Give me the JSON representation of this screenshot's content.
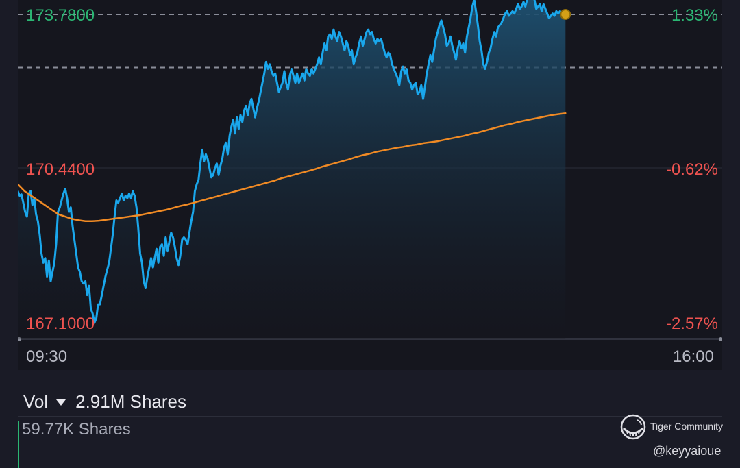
{
  "colors": {
    "price_line": "#1aa7ec",
    "avg_line": "#f08a24",
    "up_text": "#2bb673",
    "down_text": "#ef5350",
    "dashed_line": "#8a8d99",
    "time_text": "#b8bac4",
    "end_dot": "#d4a017"
  },
  "chart_data": {
    "type": "line",
    "x_labels": [
      "09:30",
      "16:00"
    ],
    "y_labels": {
      "left": [
        "173.7800",
        "170.4400",
        "167.1000"
      ],
      "right": [
        "1.33%",
        "-0.62%",
        "-2.57%"
      ]
    },
    "ylim": [
      167.1,
      173.78
    ],
    "reference_price": 171.5,
    "dashed_levels": [
      173.78,
      172.63
    ],
    "series": [
      {
        "key": "price",
        "values": [
          169.95,
          169.85,
          169.88,
          169.7,
          169.5,
          169.4,
          169.9,
          169.95,
          169.65,
          169.8,
          169.45,
          169.3,
          169.0,
          168.6,
          168.4,
          168.5,
          168.1,
          168.45,
          168.0,
          168.2,
          168.4,
          168.8,
          169.5,
          169.6,
          169.75,
          169.9,
          170.0,
          169.8,
          169.5,
          169.6,
          169.2,
          168.9,
          168.6,
          168.3,
          168.2,
          168.0,
          167.95,
          168.0,
          167.7,
          167.9,
          167.4,
          167.3,
          167.1,
          167.2,
          167.5,
          167.5,
          167.7,
          167.9,
          168.1,
          168.25,
          168.4,
          168.7,
          169.0,
          169.4,
          169.75,
          169.7,
          169.8,
          169.9,
          169.75,
          169.85,
          169.8,
          169.9,
          169.8,
          169.95,
          169.85,
          169.6,
          169.15,
          168.6,
          168.4,
          168.0,
          167.85,
          168.1,
          168.3,
          168.5,
          168.3,
          168.5,
          168.7,
          168.4,
          168.75,
          168.8,
          168.55,
          168.95,
          168.65,
          168.85,
          169.05,
          168.95,
          168.75,
          168.5,
          168.35,
          168.55,
          168.9,
          168.95,
          168.9,
          168.8,
          169.05,
          169.3,
          169.5,
          169.95,
          170.1,
          170.2,
          170.55,
          170.85,
          170.6,
          170.75,
          170.65,
          170.45,
          170.25,
          170.3,
          170.45,
          170.55,
          170.3,
          170.5,
          170.65,
          170.9,
          171.0,
          170.75,
          171.15,
          171.35,
          171.5,
          171.2,
          171.55,
          171.3,
          171.6,
          171.45,
          171.7,
          171.8,
          171.6,
          171.85,
          171.95,
          171.75,
          171.55,
          171.75,
          171.9,
          172.1,
          172.3,
          172.5,
          172.75,
          172.6,
          172.7,
          172.55,
          172.45,
          172.5,
          172.3,
          172.1,
          172.2,
          172.3,
          172.55,
          172.3,
          172.15,
          172.45,
          172.6,
          172.45,
          172.3,
          172.5,
          172.3,
          172.4,
          172.5,
          172.35,
          172.6,
          172.5,
          172.45,
          172.6,
          172.5,
          172.6,
          172.7,
          172.85,
          172.7,
          172.95,
          173.15,
          173.0,
          173.3,
          173.35,
          173.25,
          173.45,
          173.3,
          173.2,
          173.4,
          173.3,
          173.15,
          173.0,
          173.2,
          173.1,
          172.9,
          173.0,
          172.7,
          172.85,
          172.95,
          173.15,
          173.3,
          173.1,
          173.25,
          173.4,
          173.45,
          173.35,
          173.4,
          173.25,
          173.15,
          173.25,
          173.2,
          173.25,
          173.1,
          172.95,
          172.85,
          172.95,
          172.9,
          172.7,
          172.6,
          172.5,
          172.4,
          172.25,
          172.55,
          172.65,
          172.5,
          172.6,
          172.35,
          172.3,
          172.15,
          172.25,
          172.3,
          172.05,
          172.1,
          172.25,
          171.95,
          172.2,
          172.5,
          172.7,
          172.9,
          172.75,
          173.0,
          173.25,
          173.4,
          173.55,
          173.65,
          173.5,
          173.35,
          173.1,
          173.15,
          173.3,
          173.1,
          172.95,
          172.8,
          173.05,
          173.2,
          173.05,
          173.15,
          172.95,
          173.3,
          173.5,
          173.7,
          173.95,
          174.1,
          173.85,
          173.55,
          173.2,
          173.0,
          172.7,
          172.6,
          172.75,
          172.95,
          173.05,
          173.25,
          173.4,
          173.3,
          173.5,
          173.55,
          173.6,
          173.7,
          173.8,
          173.85,
          173.75,
          173.8,
          173.85,
          173.8,
          173.9,
          174.0,
          173.9,
          173.95,
          174.05,
          173.95,
          174.1,
          174.15,
          174.15,
          174.2,
          174.1,
          173.9,
          173.95,
          174.0,
          173.85,
          174.0,
          173.9,
          173.8,
          173.7,
          173.75,
          173.8,
          173.75,
          173.85,
          173.8,
          173.85,
          173.8,
          173.75,
          173.78
        ]
      },
      {
        "key": "average",
        "values": [
          170.1,
          169.95,
          169.85,
          169.75,
          169.65,
          169.55,
          169.45,
          169.4,
          169.35,
          169.32,
          169.3,
          169.3,
          169.31,
          169.33,
          169.35,
          169.37,
          169.39,
          169.41,
          169.43,
          169.46,
          169.49,
          169.52,
          169.55,
          169.59,
          169.63,
          169.66,
          169.7,
          169.74,
          169.78,
          169.82,
          169.86,
          169.9,
          169.94,
          169.98,
          170.02,
          170.06,
          170.1,
          170.14,
          170.18,
          170.23,
          170.27,
          170.31,
          170.35,
          170.39,
          170.43,
          170.48,
          170.52,
          170.56,
          170.6,
          170.64,
          170.69,
          170.73,
          170.76,
          170.8,
          170.83,
          170.86,
          170.89,
          170.91,
          170.94,
          170.96,
          170.99,
          171.01,
          171.03,
          171.06,
          171.09,
          171.12,
          171.15,
          171.19,
          171.22,
          171.26,
          171.3,
          171.34,
          171.38,
          171.41,
          171.45,
          171.48,
          171.51,
          171.54,
          171.57,
          171.6,
          171.62,
          171.64
        ]
      }
    ]
  },
  "volume": {
    "label": "Vol",
    "total": "2.91M Shares",
    "max_label": "59.77K Shares"
  },
  "watermark": {
    "logo_icon": "tiger-community-logo-icon",
    "brand": "Tiger Community",
    "handle": "@keyyaioue"
  }
}
